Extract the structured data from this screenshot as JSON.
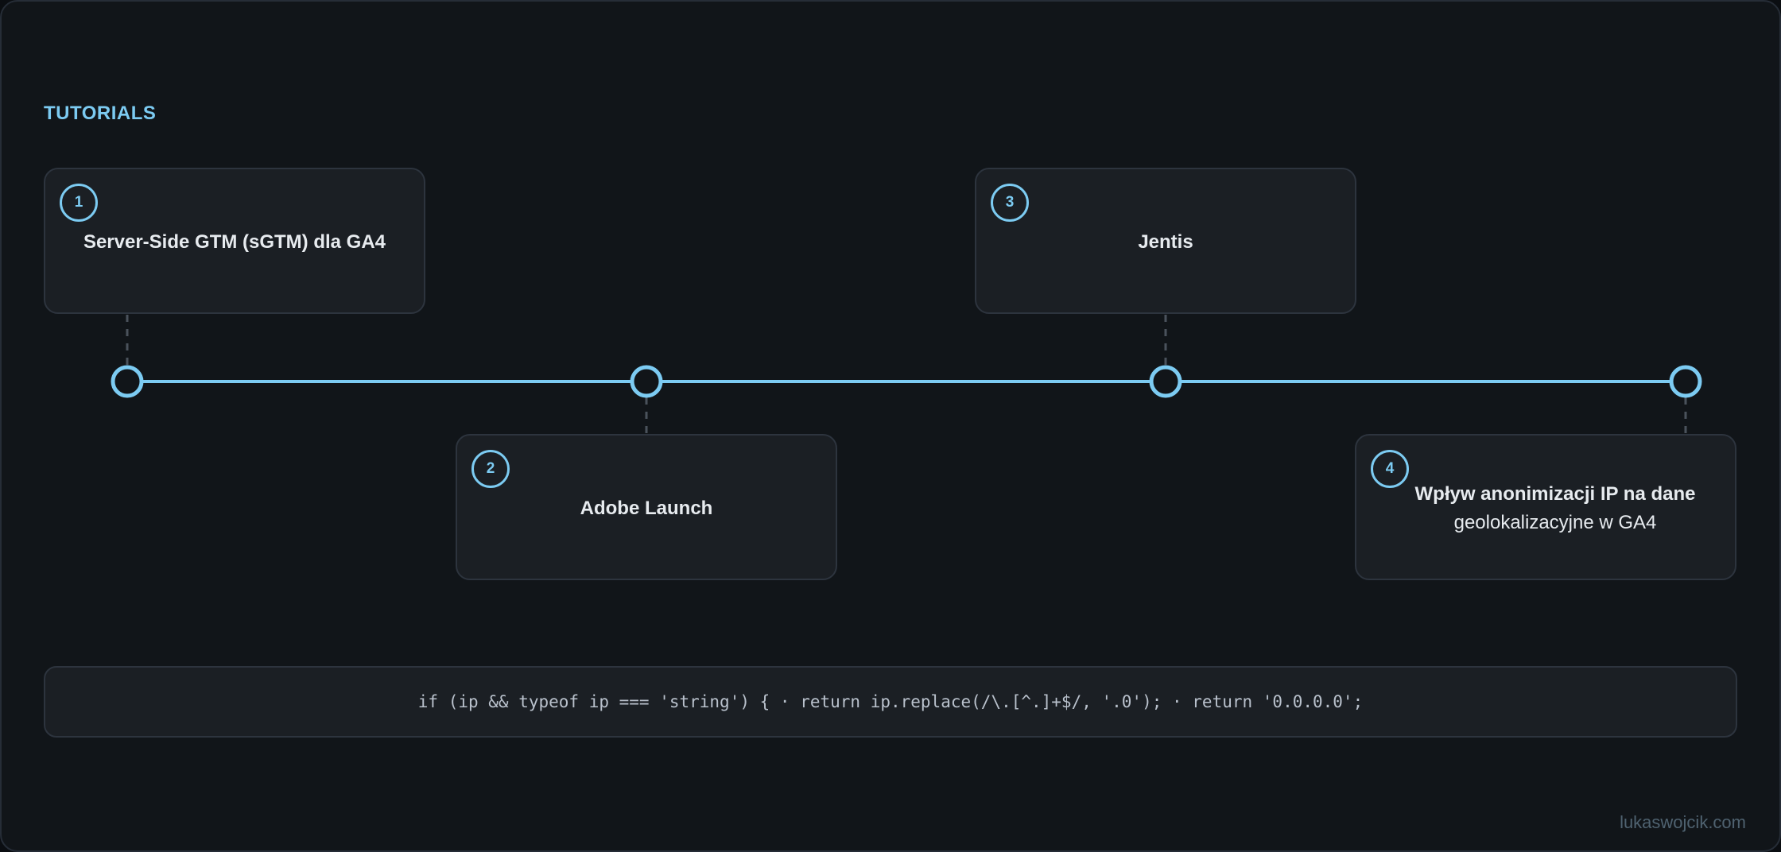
{
  "section_title": "TUTORIALS",
  "colors": {
    "accent": "#7ccbf2",
    "background": "#111519",
    "card": "#1b1f24",
    "card_border": "#2d343e",
    "connector": "#4a525c"
  },
  "tutorials": [
    {
      "number": "1",
      "title_bold": "Server-Side GTM (sGTM) dla GA4",
      "title_rest": ""
    },
    {
      "number": "2",
      "title_bold": "Adobe Launch",
      "title_rest": ""
    },
    {
      "number": "3",
      "title_bold": "Jentis",
      "title_rest": ""
    },
    {
      "number": "4",
      "title_bold": "Wpływ anonimizacji IP na dane",
      "title_rest": "geolokalizacyjne w GA4"
    }
  ],
  "code_snippet": "if (ip && typeof ip === 'string') { · return ip.replace(/\\.[^.]+$/, '.0'); · return '0.0.0.0';",
  "footer": "lukaswojcik.com"
}
